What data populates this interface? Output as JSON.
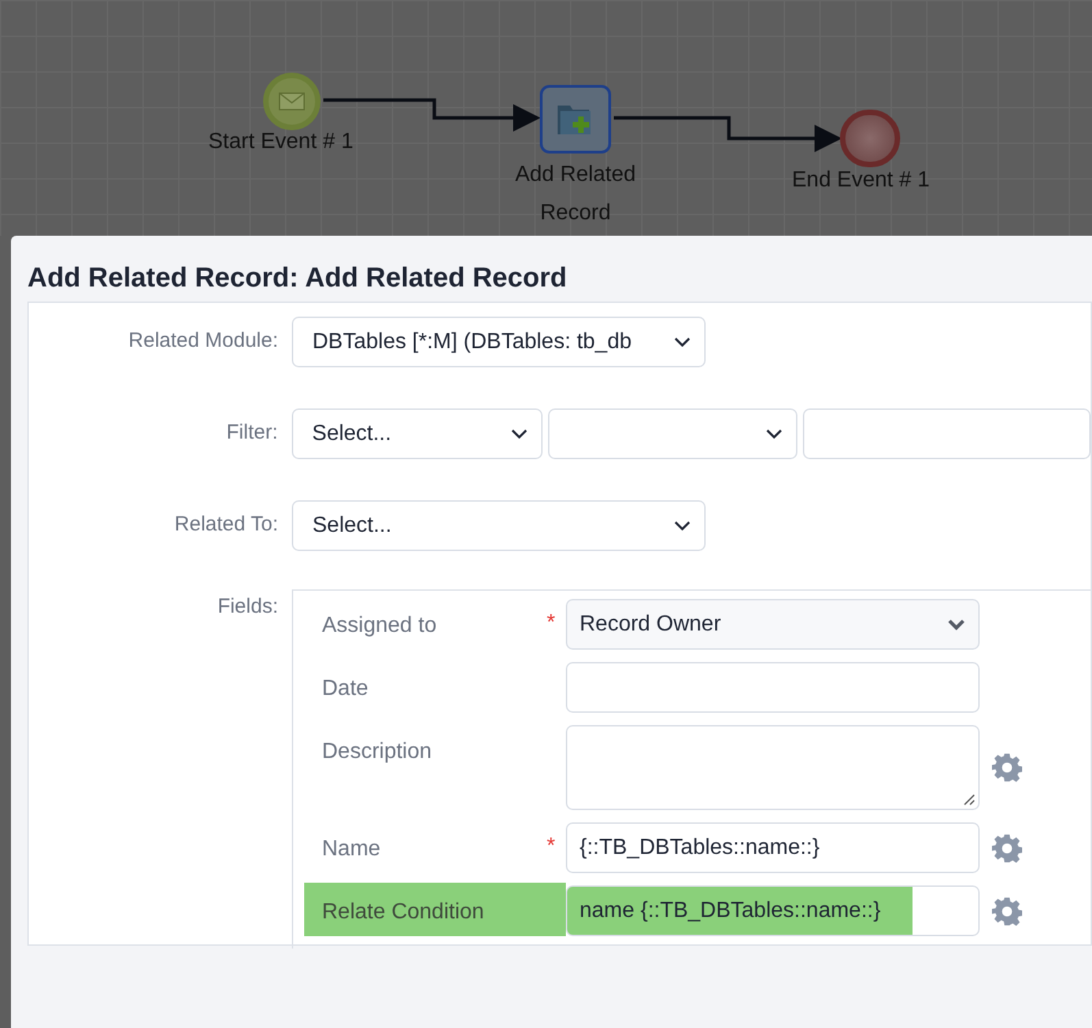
{
  "diagram": {
    "nodes": [
      {
        "kind": "start",
        "label": "Start Event # 1"
      },
      {
        "kind": "task",
        "label_lines": [
          "Add Related",
          "Record"
        ]
      },
      {
        "kind": "end",
        "label": "End Event # 1"
      }
    ]
  },
  "dialog": {
    "title": "Add Related Record: Add Related Record",
    "rows": [
      {
        "label": "Related Module:",
        "controls": [
          {
            "kind": "select",
            "value": "DBTables [*:M] (DBTables: tb_db"
          }
        ]
      },
      {
        "label": "Filter:",
        "controls": [
          {
            "kind": "select",
            "value": "Select..."
          },
          {
            "kind": "select"
          },
          {
            "kind": "input"
          }
        ]
      },
      {
        "label": "Related To:",
        "controls": [
          {
            "kind": "select",
            "value": "Select..."
          }
        ]
      }
    ],
    "fields_label": "Fields:",
    "fields": [
      {
        "label": "Assigned to",
        "required_mark": "*",
        "kind": "select",
        "value": "Record Owner",
        "settings": false,
        "highlighted": false
      },
      {
        "label": "Date",
        "kind": "input",
        "settings": false,
        "highlighted": false
      },
      {
        "label": "Description",
        "kind": "textarea",
        "settings": true,
        "highlighted": false
      },
      {
        "label": "Name",
        "required_mark": "*",
        "kind": "input",
        "value": "{::TB_DBTables::name::}",
        "settings": true,
        "highlighted": false
      },
      {
        "label": "Relate Condition",
        "kind": "input",
        "value": "name {::TB_DBTables::name::}",
        "settings": true,
        "highlighted": true
      }
    ]
  }
}
